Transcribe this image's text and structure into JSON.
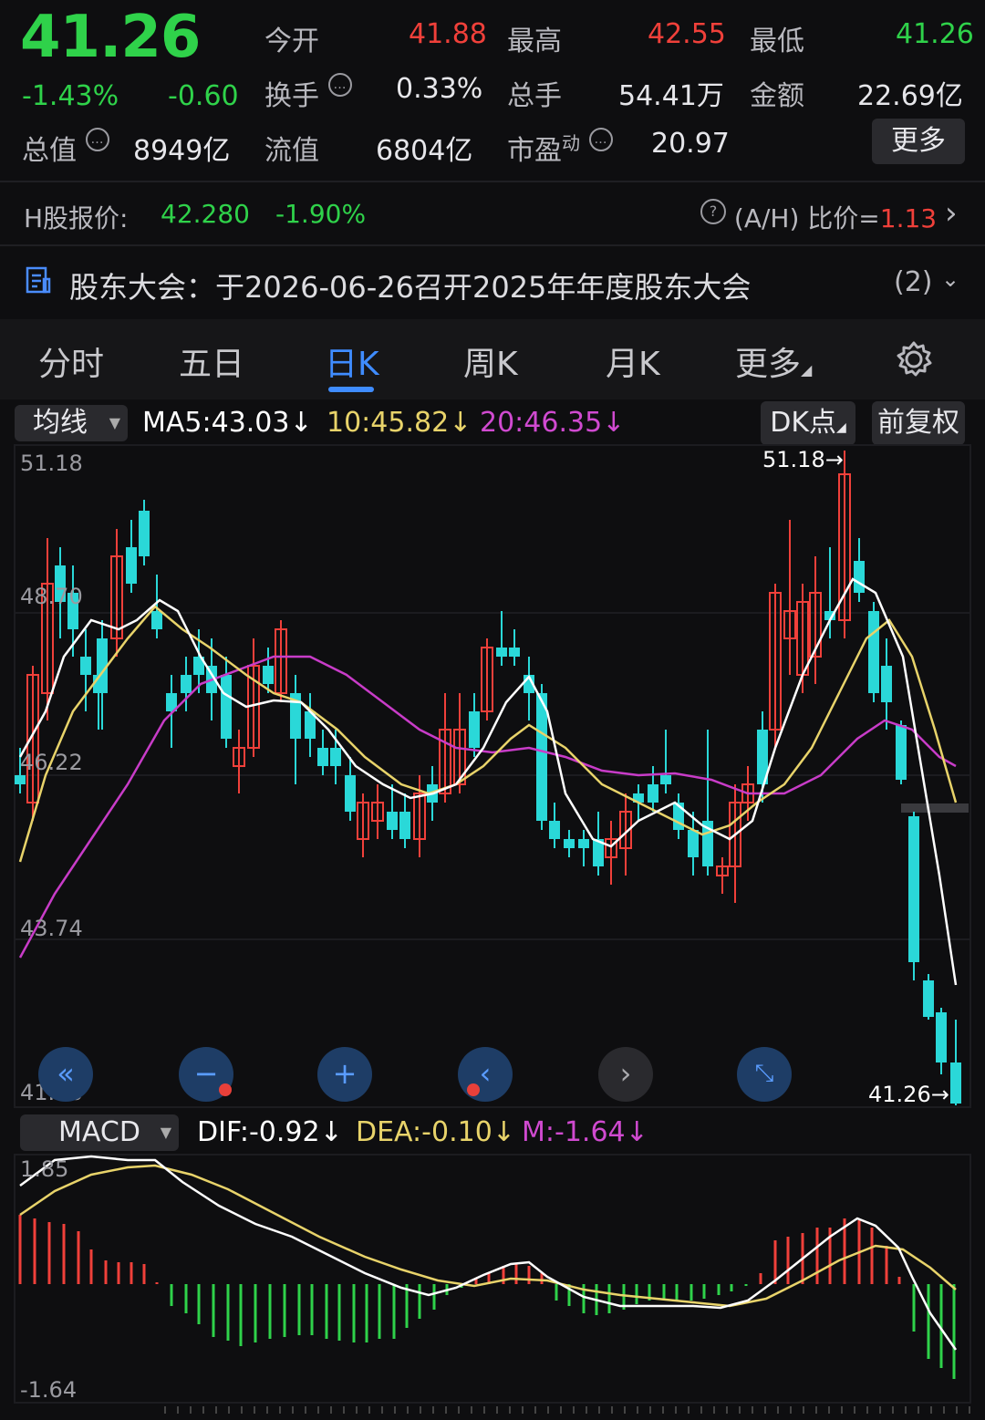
{
  "quote": {
    "price": "41.26",
    "change_pct": "-1.43%",
    "change": "-0.60",
    "fields": [
      {
        "label": "今开",
        "value": "41.88",
        "color": "red"
      },
      {
        "label": "最高",
        "value": "42.55",
        "color": "red"
      },
      {
        "label": "最低",
        "value": "41.26",
        "color": "green"
      },
      {
        "label": "换手",
        "value": "0.33%",
        "color": "white"
      },
      {
        "label": "总手",
        "value": "54.41万",
        "color": "white"
      },
      {
        "label": "金额",
        "value": "22.69亿",
        "color": "white"
      },
      {
        "label": "总值",
        "value": "8949亿",
        "color": "white"
      },
      {
        "label": "流值",
        "value": "6804亿",
        "color": "white"
      },
      {
        "label": "市盈",
        "sup": "动",
        "value": "20.97",
        "color": "white"
      }
    ],
    "more_label": "更多"
  },
  "hshare": {
    "label": "H股报价:",
    "price": "42.280",
    "change_pct": "-1.90%",
    "ah_label": "(A/H) 比价=",
    "ah_value": "1.13"
  },
  "notice": {
    "text": "股东大会：于2026-06-26召开2025年年度股东大会",
    "count": "(2)"
  },
  "tabs": [
    {
      "label": "分时"
    },
    {
      "label": "五日"
    },
    {
      "label": "日K",
      "active": true
    },
    {
      "label": "周K"
    },
    {
      "label": "月K"
    },
    {
      "label": "更多"
    }
  ],
  "ma_bar": {
    "selector": "均线",
    "ma5": "MA5:43.03",
    "ma10": "10:45.82",
    "ma20": "20:46.35",
    "dk_label": "DK点",
    "fq_label": "前复权"
  },
  "kline": {
    "y_labels": [
      "51.18",
      "48.70",
      "46.22",
      "43.74",
      "41.26"
    ],
    "max_marker": "51.18→",
    "min_marker": "41.26→",
    "ymin": 41.26,
    "ymax": 51.18
  },
  "macd": {
    "selector": "MACD",
    "dif": "DIF:-0.92",
    "dea": "DEA:-0.10",
    "m": "M:-1.64",
    "y_top": "1.85",
    "y_bottom": "-1.64"
  },
  "colors": {
    "up": "#f0403a",
    "down": "#2ad8d8",
    "ma5": "#ffffff",
    "ma10": "#e8d36a",
    "ma20": "#c83cc8",
    "accent": "#3f8cff",
    "green": "#2fd24a"
  },
  "icons": {
    "settings": "gear-icon",
    "notice": "document-icon",
    "controls": [
      "double-left-icon",
      "minus-icon",
      "plus-icon",
      "left-icon",
      "right-icon",
      "expand-icon"
    ]
  }
}
